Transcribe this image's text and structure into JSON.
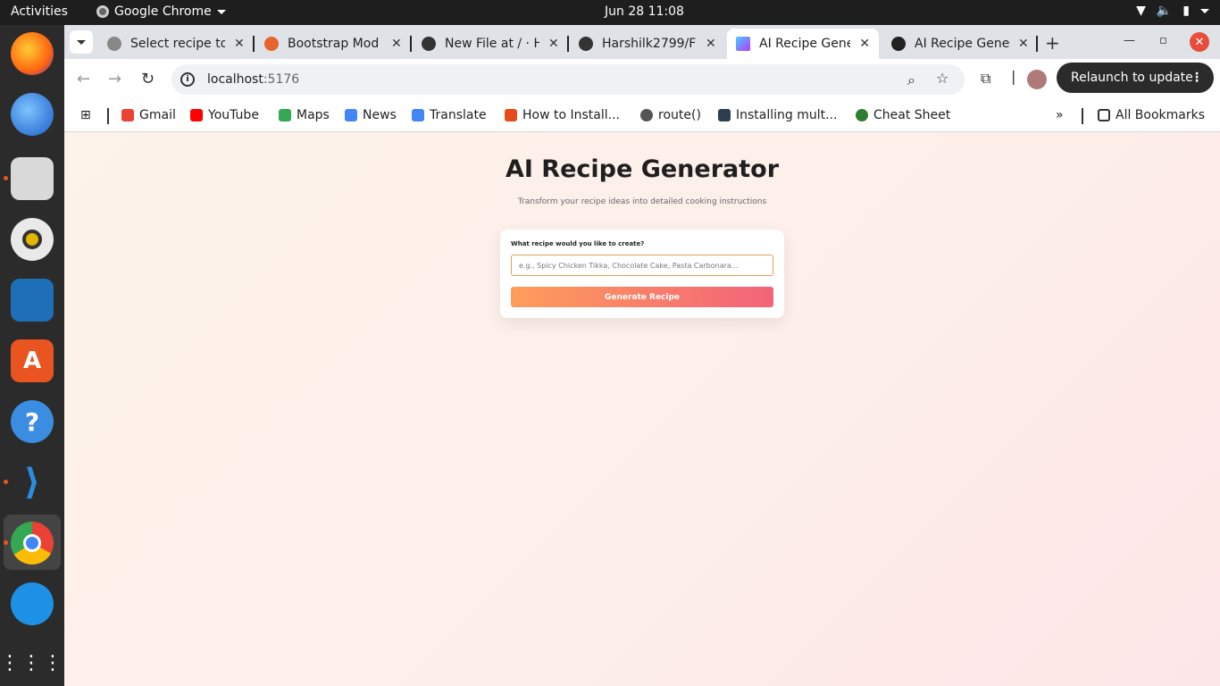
{
  "system_bar": {
    "activities": "Activities",
    "app_name": "Google Chrome",
    "clock": "Jun 28  11:08"
  },
  "browser": {
    "tabs": [
      {
        "title": "Select recipe to",
        "active": false
      },
      {
        "title": "Bootstrap Mod",
        "active": false
      },
      {
        "title": "New File at / · H",
        "active": false
      },
      {
        "title": "Harshilk2799/F",
        "active": false
      },
      {
        "title": "AI Recipe Gene",
        "active": true
      },
      {
        "title": "AI Recipe Gene",
        "active": false
      }
    ],
    "url_host": "localhost",
    "url_port": ":5176",
    "relaunch_label": "Relaunch to update",
    "bookmarks": [
      {
        "label": "Gmail",
        "color": "#ea4335"
      },
      {
        "label": "YouTube",
        "color": "#ff0000"
      },
      {
        "label": "Maps",
        "color": "#34a853"
      },
      {
        "label": "News",
        "color": "#4285f4"
      },
      {
        "label": "Translate",
        "color": "#4285f4"
      },
      {
        "label": "How to Install...",
        "color": "#e64a19"
      },
      {
        "label": "route()",
        "color": "#555555"
      },
      {
        "label": "Installing mult...",
        "color": "#2c3e50"
      },
      {
        "label": "Cheat Sheet",
        "color": "#2e7d32"
      }
    ],
    "all_bookmarks": "All Bookmarks"
  },
  "app": {
    "title": "AI Recipe Generator",
    "subtitle": "Transform your recipe ideas into detailed cooking instructions",
    "form": {
      "label": "What recipe would you like to create?",
      "placeholder": "e.g., Spicy Chicken Tikka, Chocolate Cake, Pasta Carbonara...",
      "value": "",
      "button_label": "Generate Recipe"
    },
    "colors": {
      "button_gradient_start": "#fe9d5a",
      "button_gradient_end": "#f3637a",
      "input_border": "#e0a25a"
    }
  }
}
